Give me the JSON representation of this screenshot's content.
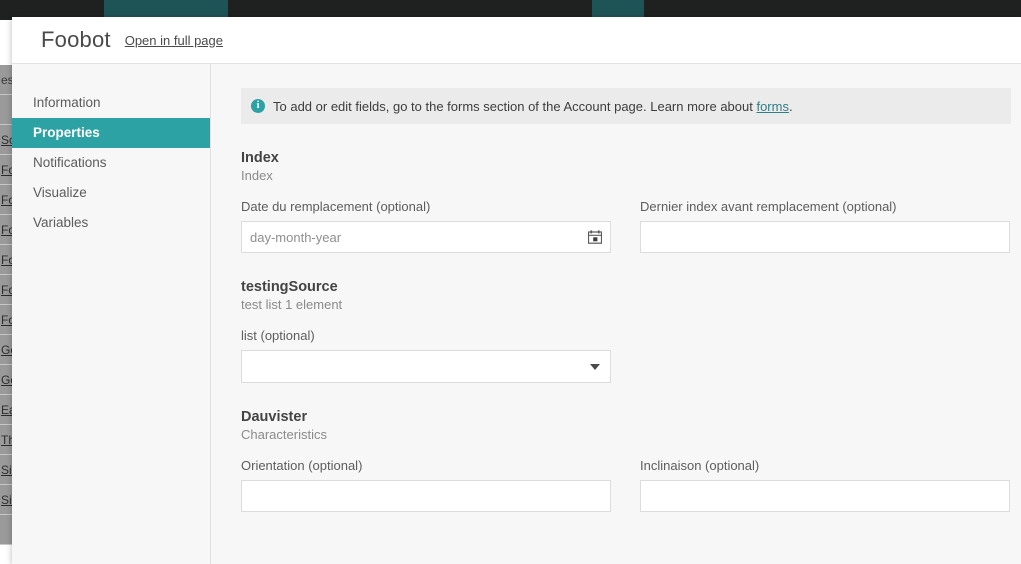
{
  "background": {
    "navbar": {
      "tabs": [
        {
          "name": "nav-tab-active-1",
          "highlight": true
        },
        {
          "name": "nav-tab-active-2",
          "highlight": true
        }
      ]
    },
    "table_rows": [
      {
        "text": "es"
      },
      {
        "text": ""
      },
      {
        "text": "So"
      },
      {
        "text": "Foo"
      },
      {
        "text": "Foo"
      },
      {
        "text": "Foo"
      },
      {
        "text": "Foo"
      },
      {
        "text": "Foo"
      },
      {
        "text": "Foo"
      },
      {
        "text": "Gé"
      },
      {
        "text": "Gé"
      },
      {
        "text": "Eau"
      },
      {
        "text": "The"
      },
      {
        "text": "Sim"
      },
      {
        "text": "Sim"
      },
      {
        "text": ""
      }
    ]
  },
  "modal": {
    "title": "Foobot",
    "open_full_page_label": "Open in full page",
    "sidebar": {
      "items": [
        {
          "label": "Information",
          "active": false
        },
        {
          "label": "Properties",
          "active": true
        },
        {
          "label": "Notifications",
          "active": false
        },
        {
          "label": "Visualize",
          "active": false
        },
        {
          "label": "Variables",
          "active": false
        }
      ]
    },
    "banner": {
      "icon": "info-icon",
      "text_before": "To add or edit fields, go to the forms section of the Account page. Learn more about ",
      "link_label": "forms",
      "text_after": "."
    },
    "sections": [
      {
        "title": "Index",
        "subtitle": "Index",
        "fields": [
          {
            "label": "Date du remplacement (optional)",
            "placeholder": "day-month-year",
            "value": "",
            "type": "date",
            "icon": "calendar-icon"
          },
          {
            "label": "Dernier index avant remplacement (optional)",
            "placeholder": "",
            "value": "",
            "type": "text",
            "icon": ""
          }
        ]
      },
      {
        "title": "testingSource",
        "subtitle": "test list 1 element",
        "fields": [
          {
            "label": "list (optional)",
            "placeholder": "",
            "value": "",
            "type": "select",
            "icon": "chevron-down-icon"
          }
        ]
      },
      {
        "title": "Dauvister",
        "subtitle": "Characteristics",
        "fields": [
          {
            "label": "Orientation (optional)",
            "placeholder": "",
            "value": "",
            "type": "text",
            "icon": ""
          },
          {
            "label": "Inclinaison (optional)",
            "placeholder": "",
            "value": "",
            "type": "text",
            "icon": ""
          }
        ]
      }
    ]
  },
  "colors": {
    "accent_teal": "#2da2a4",
    "navbar_dark": "#1f2121",
    "navbar_tab_teal": "#1f5457",
    "link_teal": "#2f7f86",
    "panel_bg": "#f7f7f7",
    "banner_bg": "#ebebeb"
  }
}
